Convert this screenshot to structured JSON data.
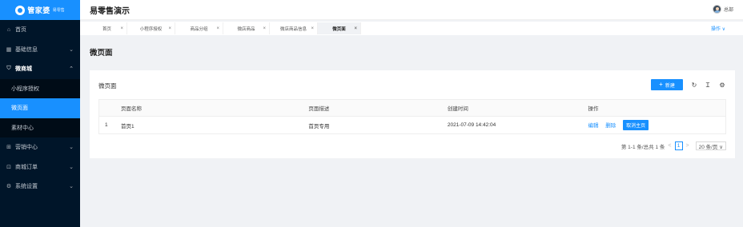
{
  "sidebar": {
    "brand": "管家婆",
    "brand_sub": "易零售",
    "items": [
      {
        "label": "首页",
        "icon": "home-icon"
      },
      {
        "label": "基础信息",
        "icon": "grid-icon"
      },
      {
        "label": "微商城",
        "icon": "shop-icon"
      },
      {
        "label": "营销中心",
        "icon": "gift-icon"
      },
      {
        "label": "商城订单",
        "icon": "cart-icon"
      },
      {
        "label": "系统设置",
        "icon": "gear-icon"
      }
    ],
    "sub_items": [
      {
        "label": "小程序授权"
      },
      {
        "label": "微页面"
      },
      {
        "label": "素材中心"
      }
    ]
  },
  "header": {
    "title": "易零售演示",
    "user": "总部"
  },
  "tabs": {
    "items": [
      {
        "label": "首页"
      },
      {
        "label": "小程序授权"
      },
      {
        "label": "商品分组"
      },
      {
        "label": "微店商品"
      },
      {
        "label": "微店商品信息"
      },
      {
        "label": "微页面"
      }
    ],
    "close_glyph": "×",
    "operate": "操作 ∨"
  },
  "page": {
    "title": "微页面"
  },
  "card": {
    "title": "微页面",
    "new_button": "新建",
    "plus_glyph": "+",
    "table": {
      "headers": [
        "",
        "页面名称",
        "页面描述",
        "创建时间",
        "操作"
      ],
      "rows": [
        {
          "index": "1",
          "name": "首页1",
          "desc": "首页专用",
          "created": "2021-07-09 14:42:04",
          "actions": [
            "编辑",
            "删除"
          ],
          "primary_action": "取消主页"
        }
      ]
    },
    "pagination": {
      "summary": "第 1-1 条/总共 1 条",
      "prev": "<",
      "current": "1",
      "next": ">",
      "page_size": "20 条/页 ∨"
    }
  },
  "colors": {
    "primary": "#1890ff",
    "sidebar_bg": "#001529"
  }
}
